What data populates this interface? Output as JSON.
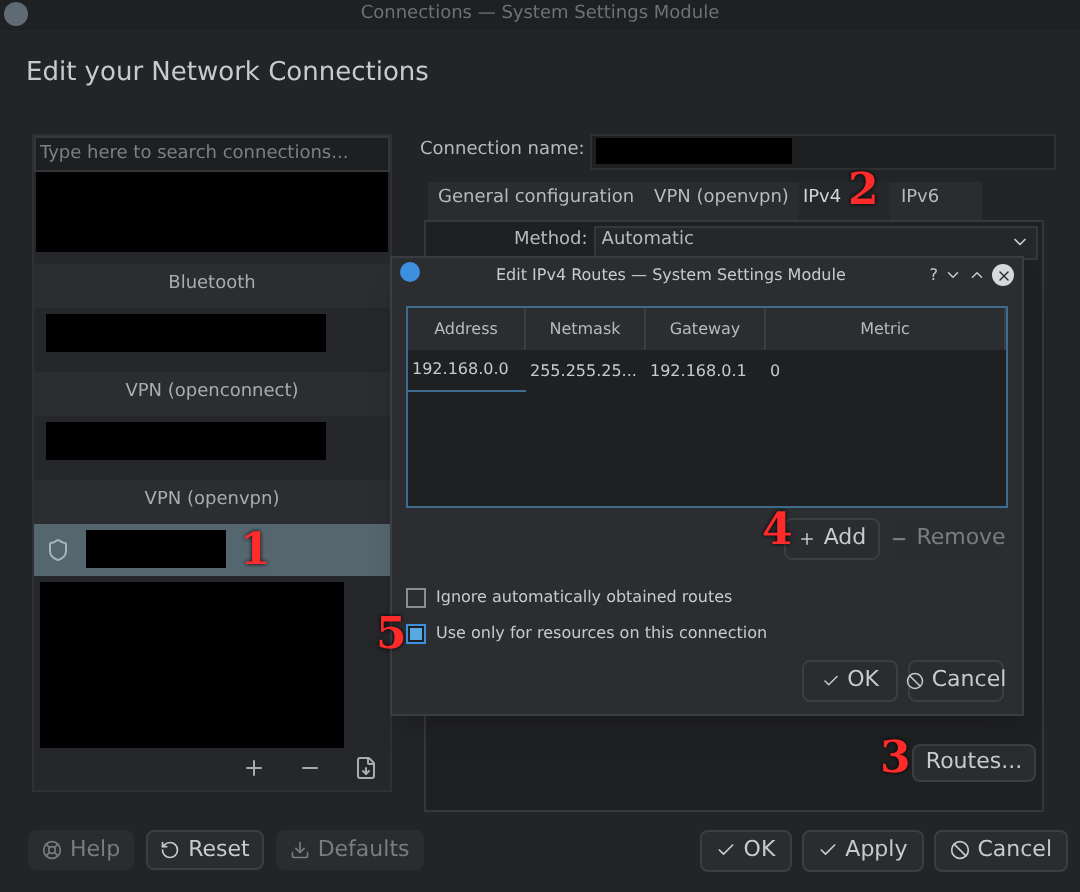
{
  "window": {
    "title": "Connections — System Settings Module"
  },
  "heading": "Edit your Network Connections",
  "search": {
    "placeholder": "Type here to search connections..."
  },
  "connection_groups": [
    {
      "title": "Bluetooth",
      "items": [
        {
          "selected": false
        }
      ]
    },
    {
      "title": "VPN (openconnect)",
      "items": [
        {
          "selected": false
        }
      ]
    },
    {
      "title": "VPN (openvpn)",
      "items": [
        {
          "selected": true
        }
      ]
    }
  ],
  "connection_name": {
    "label": "Connection name:"
  },
  "tabs": [
    {
      "label": "General configuration",
      "selected": false
    },
    {
      "label": "VPN (openvpn)",
      "selected": false
    },
    {
      "label": "IPv4",
      "selected": true
    },
    {
      "label": "IPv6",
      "selected": false
    }
  ],
  "method": {
    "label": "Method:",
    "value": "Automatic"
  },
  "routes_button": "Routes...",
  "footer_left": [
    {
      "label": "Help",
      "disabled": true
    },
    {
      "label": "Reset",
      "disabled": false
    },
    {
      "label": "Defaults",
      "disabled": true
    }
  ],
  "footer_right": [
    "OK",
    "Apply",
    "Cancel"
  ],
  "dialog": {
    "title": "Edit IPv4 Routes — System Settings Module",
    "help_glyph": "?",
    "columns": [
      "Address",
      "Netmask",
      "Gateway",
      "Metric"
    ],
    "rows": [
      [
        "192.168.0.0",
        "255.255.25...",
        "192.168.0.1",
        "0"
      ]
    ],
    "add": {
      "label": "Add",
      "disabled": false
    },
    "remove": {
      "label": "Remove",
      "disabled": true
    },
    "options": [
      {
        "label": "Ignore automatically obtained routes",
        "checked": false
      },
      {
        "label": "Use only for resources on this connection",
        "checked": true
      }
    ],
    "buttons": [
      "OK",
      "Cancel"
    ]
  },
  "annotations": [
    "1",
    "2",
    "3",
    "4",
    "5"
  ]
}
